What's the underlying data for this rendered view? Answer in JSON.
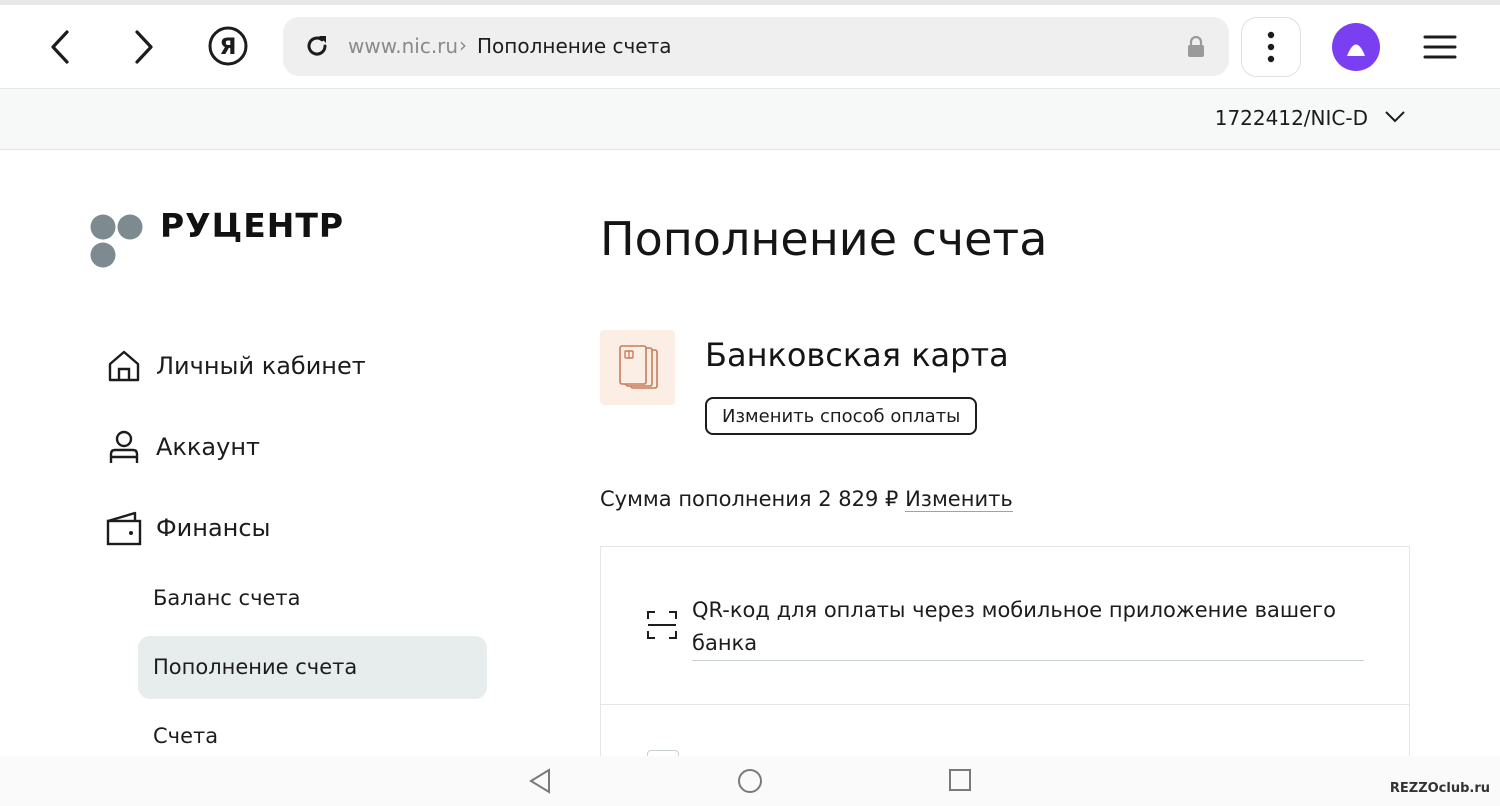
{
  "browser": {
    "url_host": "www.nic.ru",
    "url_separator": "›",
    "page_title": "Пополнение счета"
  },
  "account": {
    "id": "1722412/NIC-D"
  },
  "logo": {
    "text": "РУЦЕНТР"
  },
  "sidebar": {
    "items": [
      {
        "label": "Личный кабинет",
        "icon": "home-icon"
      },
      {
        "label": "Аккаунт",
        "icon": "user-icon"
      },
      {
        "label": "Финансы",
        "icon": "wallet-icon"
      }
    ],
    "sub_items": [
      {
        "label": "Баланс счета",
        "active": false
      },
      {
        "label": "Пополнение счета",
        "active": true
      },
      {
        "label": "Счета",
        "active": false
      }
    ]
  },
  "main": {
    "title": "Пополнение счета",
    "payment_method": "Банковская карта",
    "change_method_button": "Изменить способ оплаты",
    "amount_prefix": "Сумма пополнения 2 829 ₽",
    "amount_edit": "Изменить",
    "options": [
      {
        "label": "QR-код для оплаты через мобильное приложение вашего банка",
        "icon": "qr-scan-icon"
      }
    ]
  },
  "colors": {
    "alice_accent": "#7b3ff2",
    "card_tile_bg": "#fbeee5",
    "card_icon": "#c97b5a",
    "active_item_bg": "#e7ecec"
  },
  "watermark": "REZZOclub.ru"
}
